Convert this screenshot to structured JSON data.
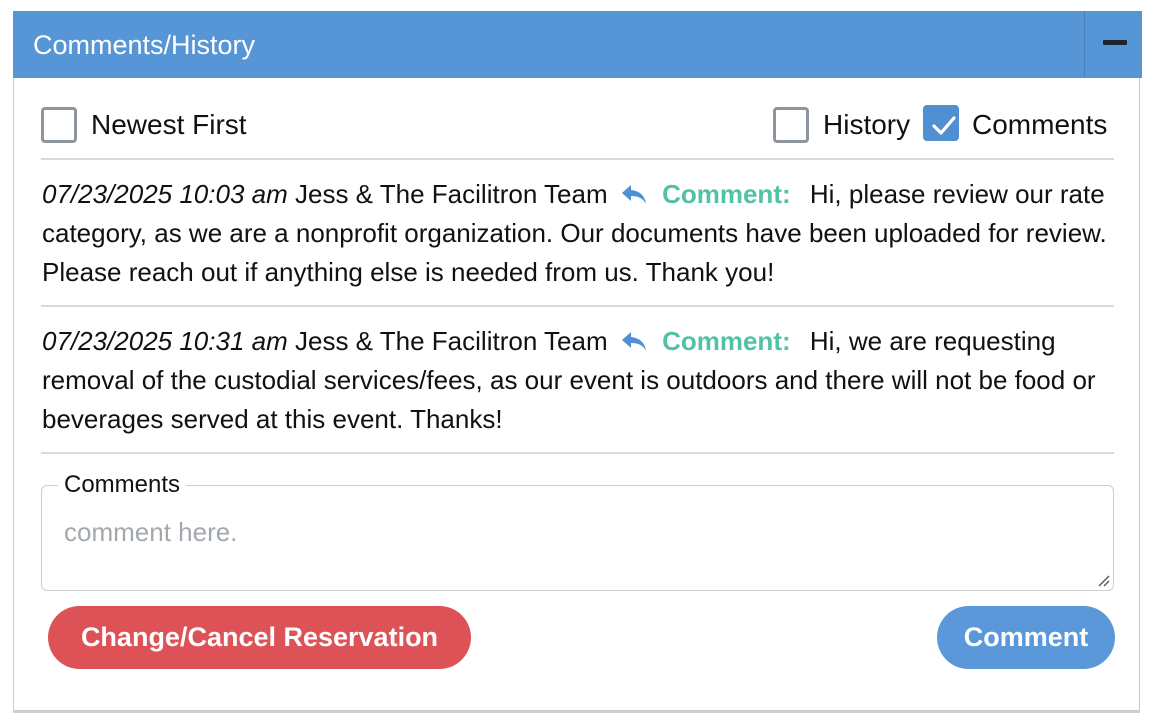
{
  "panel": {
    "title": "Comments/History",
    "collapse_icon": "minus-icon"
  },
  "filters": {
    "newest_first": {
      "label": "Newest First",
      "checked": false
    },
    "history": {
      "label": "History",
      "checked": false
    },
    "comments": {
      "label": "Comments",
      "checked": true
    }
  },
  "entries": [
    {
      "timestamp": "07/23/2025 10:03 am",
      "author": "Jess & The Facilitron Team",
      "icon": "reply-icon",
      "kind": "Comment:",
      "text": "Hi, please review our rate category, as we are a nonprofit organization. Our documents have been uploaded for review. Please reach out if anything else is needed from us. Thank you!"
    },
    {
      "timestamp": "07/23/2025 10:31 am",
      "author": "Jess & The Facilitron Team",
      "icon": "reply-icon",
      "kind": "Comment:",
      "text": "Hi, we are requesting removal of the custodial services/fees, as our event is outdoors and there will not be food or beverages served at this event. Thanks!"
    }
  ],
  "comment_form": {
    "legend": "Comments",
    "placeholder": "comment here.",
    "value": ""
  },
  "buttons": {
    "change_cancel": "Change/Cancel Reservation",
    "comment": "Comment"
  },
  "colors": {
    "header": "#5695d6",
    "accent_comment": "#52c2a7",
    "danger": "#dd5257",
    "primary": "#5a98da"
  }
}
